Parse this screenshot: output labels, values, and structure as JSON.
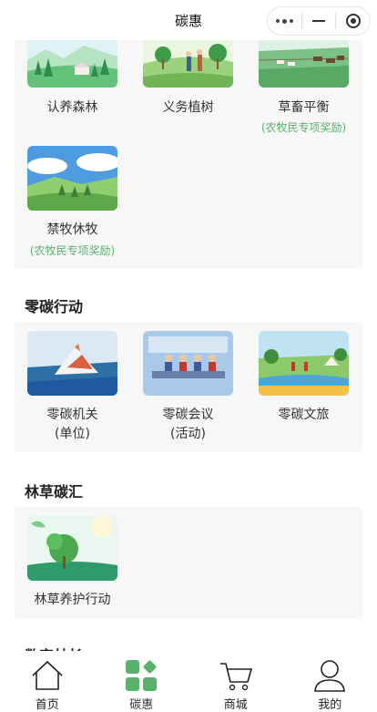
{
  "header": {
    "title": "碳惠"
  },
  "colors": {
    "accent": "#5ab16c",
    "card_bg": "#f7f7f7"
  },
  "top_section": {
    "items": [
      {
        "label": "认养森林",
        "sub": ""
      },
      {
        "label": "义务植树",
        "sub": ""
      },
      {
        "label": "草畜平衡",
        "sub": "(农牧民专项奖励)"
      },
      {
        "label": "禁牧休牧",
        "sub": "(农牧民专项奖励)"
      }
    ]
  },
  "zero_carbon": {
    "title": "零碳行动",
    "items": [
      {
        "label_line1": "零碳机关",
        "label_line2": "(单位)"
      },
      {
        "label_line1": "零碳会议",
        "label_line2": "(活动)"
      },
      {
        "label_line1": "零碳文旅",
        "label_line2": ""
      }
    ]
  },
  "forest_sink": {
    "title": "林草碳汇",
    "items": [
      {
        "label": "林草养护行动"
      }
    ]
  },
  "digital": {
    "title": "数字林长"
  },
  "tabbar": {
    "tabs": [
      {
        "label": "首页",
        "icon": "home-icon"
      },
      {
        "label": "碳惠",
        "icon": "grid-icon",
        "active": true
      },
      {
        "label": "商城",
        "icon": "cart-icon"
      },
      {
        "label": "我的",
        "icon": "user-icon"
      }
    ]
  }
}
